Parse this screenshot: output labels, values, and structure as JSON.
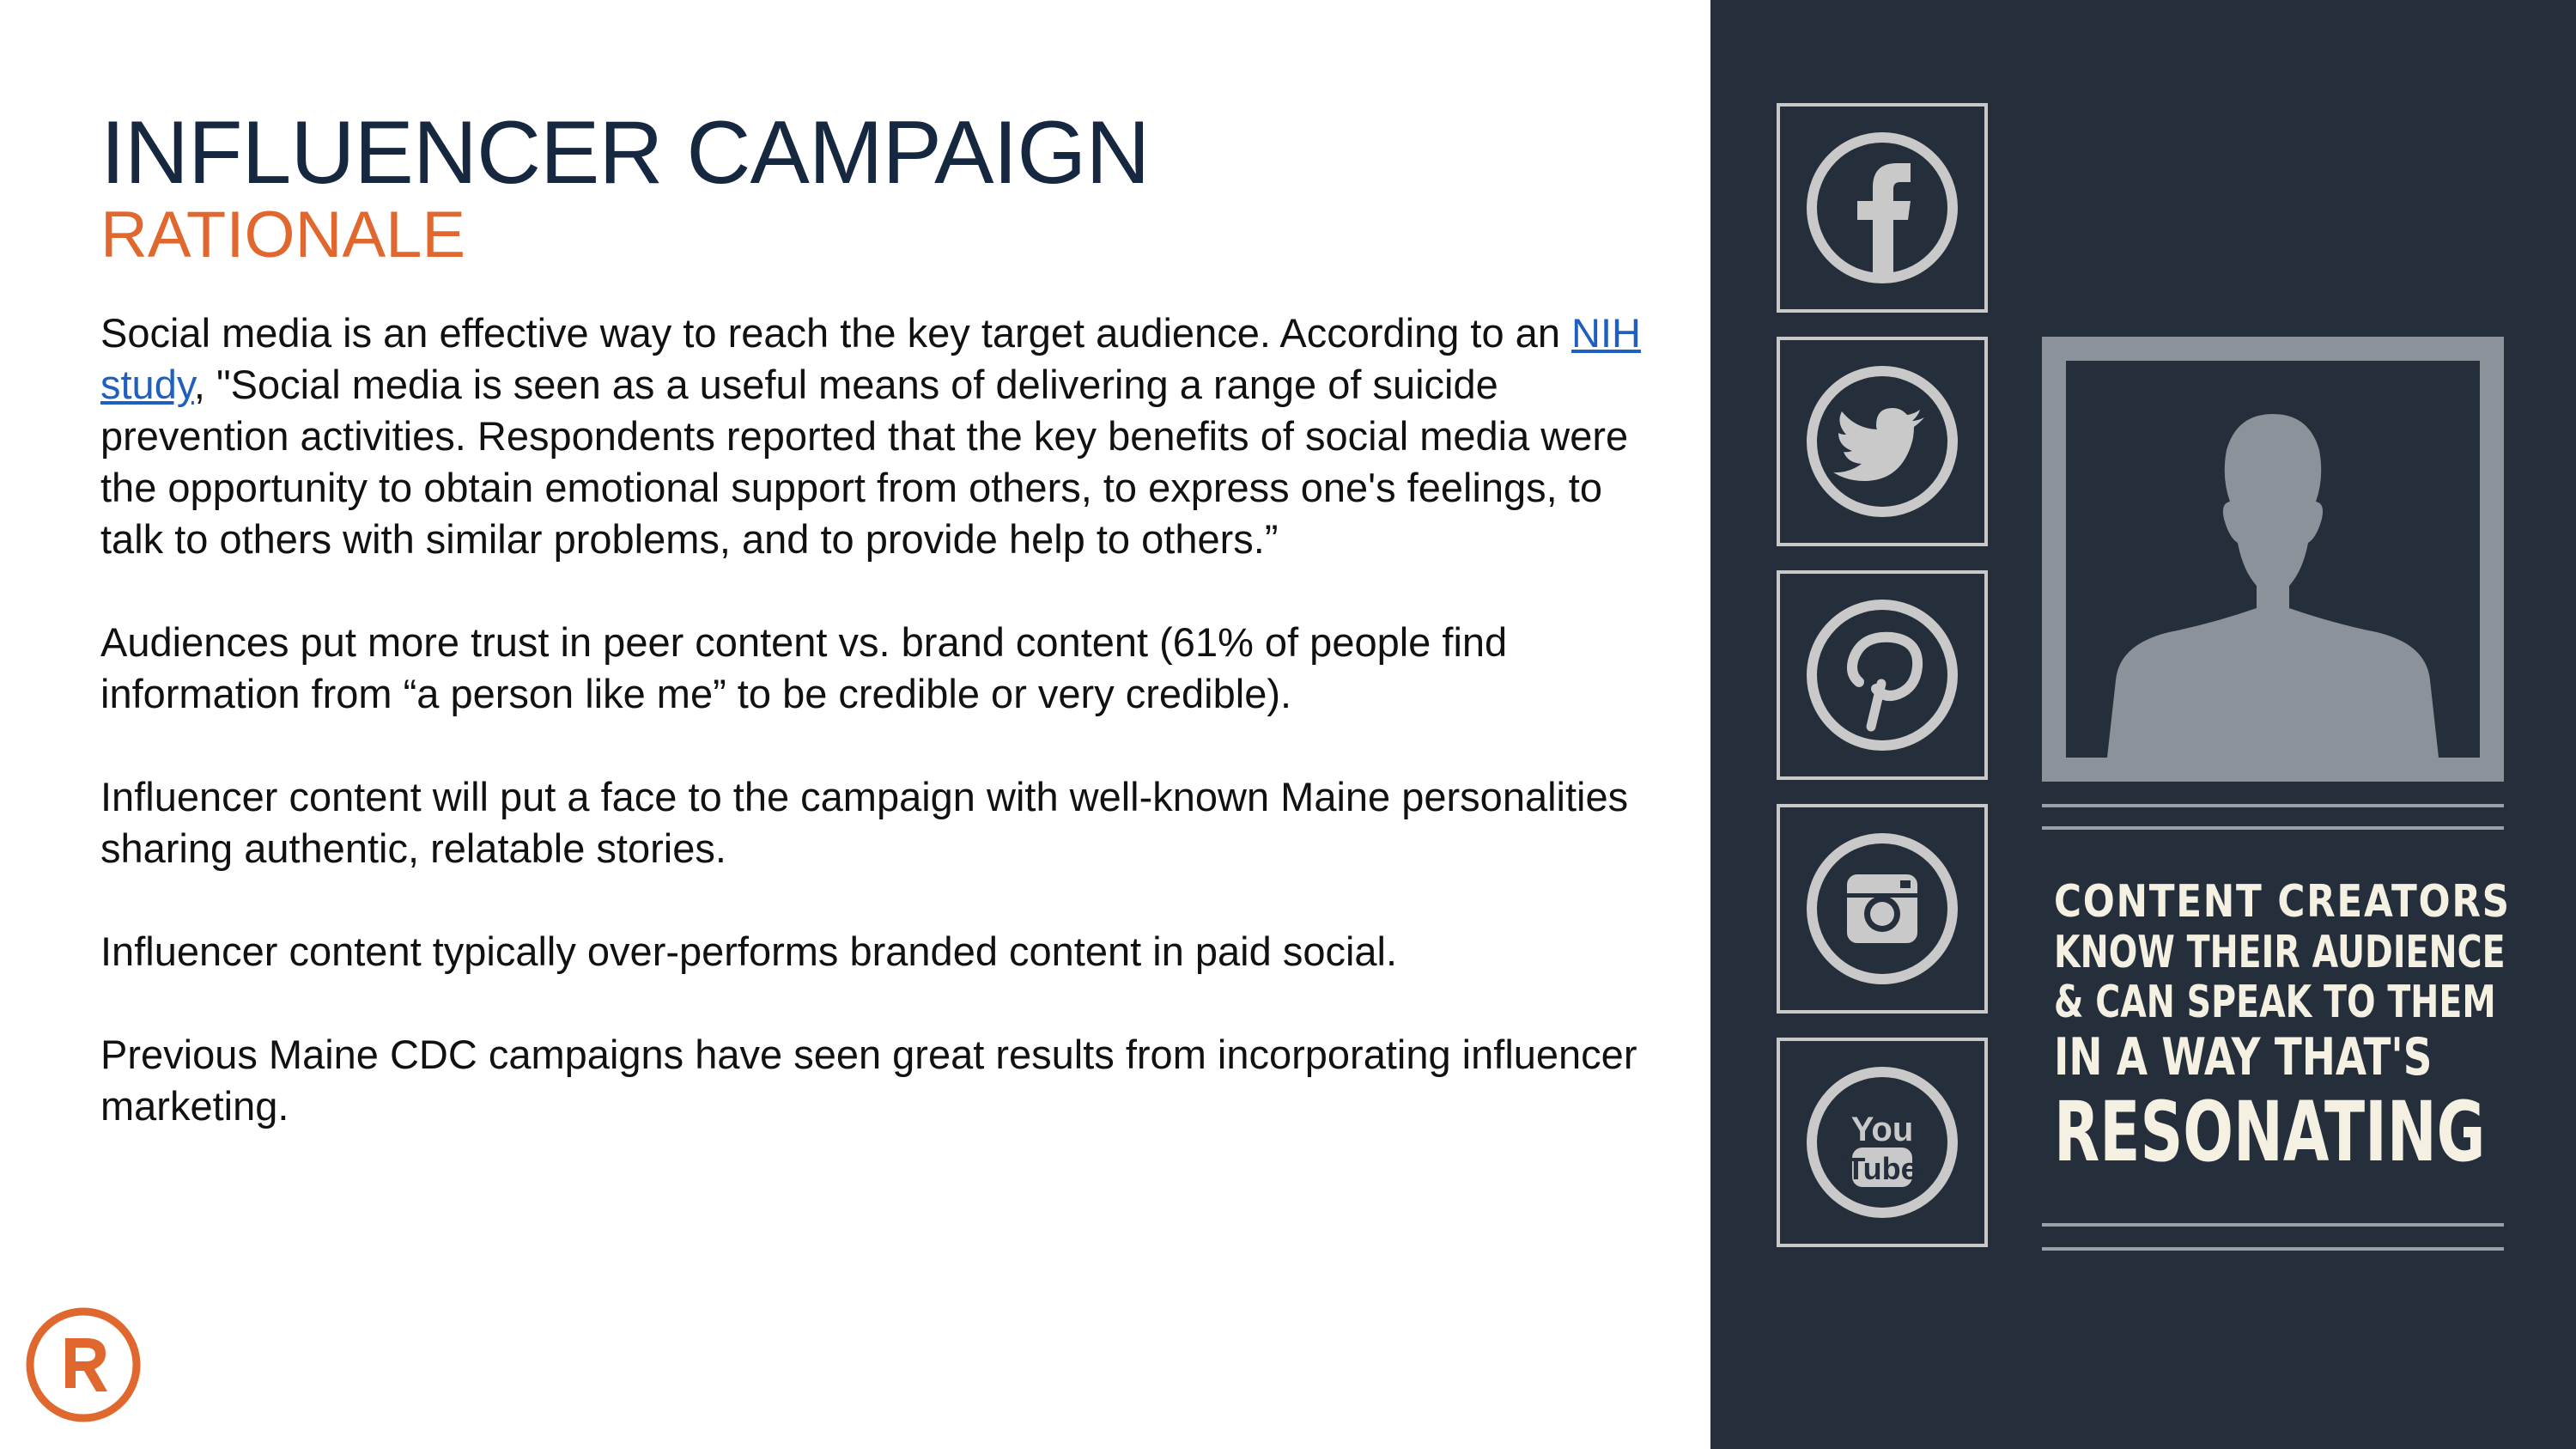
{
  "slide": {
    "title": "INFLUENCER CAMPAIGN",
    "subtitle": "RATIONALE",
    "paragraph1_lead": "Social media is an effective way to reach the key target audience. According to an ",
    "paragraph1_link": "NIH study",
    "paragraph1_rest": ", \"Social media is seen as a useful means of delivering a range of suicide prevention activities. Respondents reported that the key benefits of social media were the opportunity to obtain emotional support from others, to express one's feelings, to talk to others with similar problems, and to provide help to others.”",
    "paragraph2": "Audiences put more trust in peer content vs. brand content (61% of people find information from “a person like me” to be credible or very credible).",
    "paragraph3": "Influencer content will put a face to the campaign with well-known Maine personalities sharing authentic, relatable stories.",
    "paragraph4": "Influencer content typically over-performs branded content in paid social.",
    "paragraph5": "Previous Maine CDC campaigns have seen great results from incorporating influencer marketing."
  },
  "graphic": {
    "social_icons": [
      "facebook-icon",
      "twitter-icon",
      "pinterest-icon",
      "instagram-icon",
      "youtube-icon"
    ],
    "youtube_text_top": "You",
    "youtube_text_bottom": "Tube",
    "slogan_line1": "CONTENT CREATORS",
    "slogan_line2": "KNOW THEIR AUDIENCE",
    "slogan_line3": "& CAN SPEAK TO THEM",
    "slogan_line4": "IN A WAY THAT'S",
    "slogan_line5": "RESONATING"
  },
  "colors": {
    "title": "#162740",
    "accent": "#e0672e",
    "panel": "#252e3b",
    "link": "#1f5fbf"
  }
}
